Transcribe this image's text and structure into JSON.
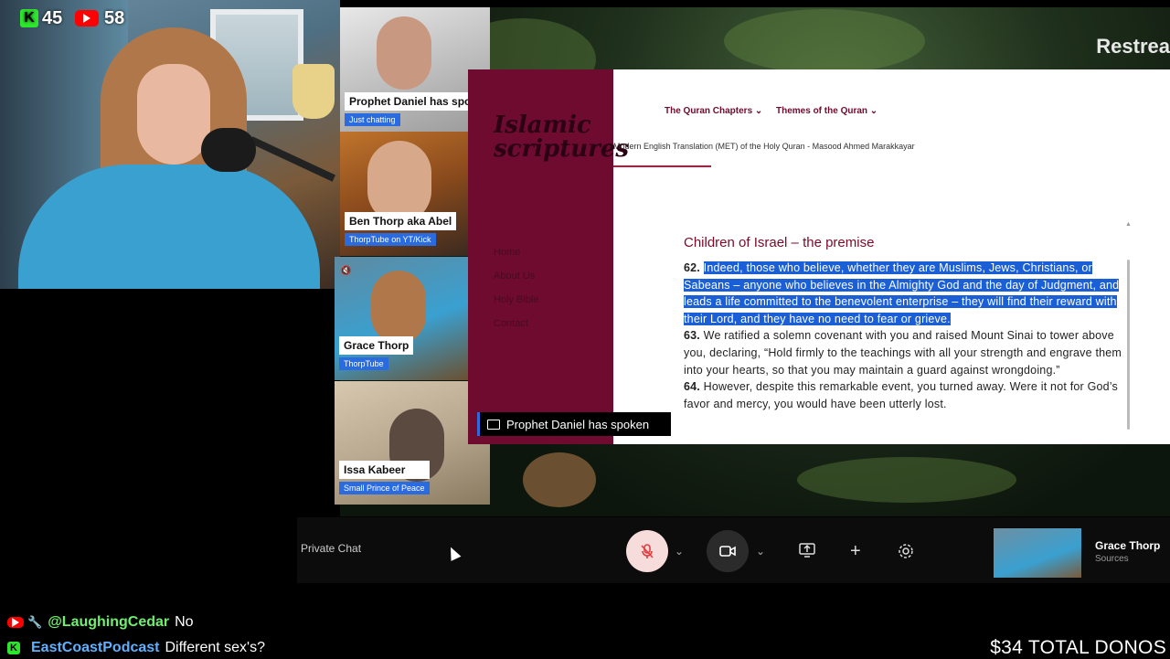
{
  "overlay": {
    "kick_count": "45",
    "youtube_count": "58",
    "kick_logo": "K",
    "total_donos": "$34 TOTAL DONOS"
  },
  "stage": {
    "restream_label": "Restrea",
    "share_banner": "Prophet Daniel has spoken"
  },
  "participants": [
    {
      "name": "Prophet Daniel has spok",
      "sub": "Just chatting"
    },
    {
      "name": "Ben Thorp aka Abel",
      "sub": "ThorpTube on YT/Kick"
    },
    {
      "name": "Grace Thorp",
      "sub": "ThorpTube"
    },
    {
      "name": "Issa Kabeer",
      "sub": "Small Prince of Peace"
    }
  ],
  "screen": {
    "logo_line1": "Islamic",
    "logo_line2": "scriptures",
    "nav": [
      "The Quran Chapters ⌄",
      "Themes of the Quran ⌄"
    ],
    "subtitle": "Modern English Translation (MET) of the Holy Quran - Masood Ahmed Marakkayar",
    "menu": [
      "Home",
      "About Us",
      "Holy Bible",
      "Contact"
    ],
    "heading": "Children of Israel – the premise",
    "verse62_num": "62.",
    "verse62_text": "Indeed, those who believe, whether they are Muslims, Jews, Christians, or Sabeans – anyone who believes in the Almighty God and the day of Judgment, and leads a life committed to the benevolent enterprise – they will find their reward with their Lord, and they have no need to fear or grieve.",
    "verse63_num": "63.",
    "verse63_text": "We ratified a solemn covenant with you and raised Mount Sinai to tower above you, declaring, “Hold firmly to the teachings with all your strength and engrave them into your hearts, so that you may maintain a guard against wrongdoing.”",
    "verse64_num": "64.",
    "verse64_text": "However, despite this remarkable event, you turned away. Were it not for God’s favor and mercy, you would have been utterly lost."
  },
  "controls": {
    "private_chat": "Private Chat",
    "self_name": "Grace Thorp",
    "self_sub": "Sources"
  },
  "chat": [
    {
      "user": "@LaughingCedar",
      "message": "No"
    },
    {
      "user": "EastCoastPodcast",
      "message": "Different sex's?"
    }
  ],
  "colors": {
    "kick": "#2ee52e",
    "youtube": "#ff0000",
    "accent": "#2a6be0",
    "site": "#6e0b2e"
  }
}
